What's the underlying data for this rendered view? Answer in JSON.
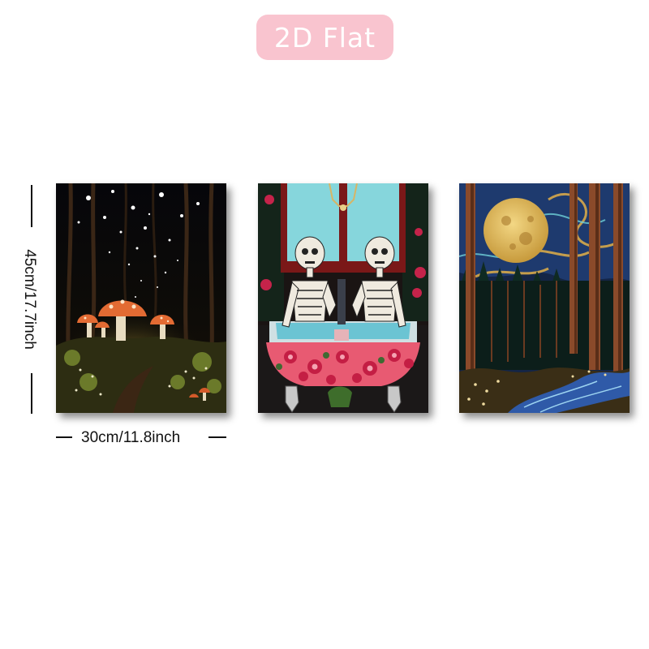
{
  "badge": {
    "label": "2D Flat",
    "background": "#f9c4cf"
  },
  "dimensions": {
    "height_label": "45cm/17.7inch",
    "width_label": "30cm/11.8inch"
  },
  "panels": [
    {
      "subject": "glowing mushrooms in a starry night forest"
    },
    {
      "subject": "two skeletons in a red floral clawfoot bathtub"
    },
    {
      "subject": "full moon over a swirling night forest with a river"
    }
  ]
}
